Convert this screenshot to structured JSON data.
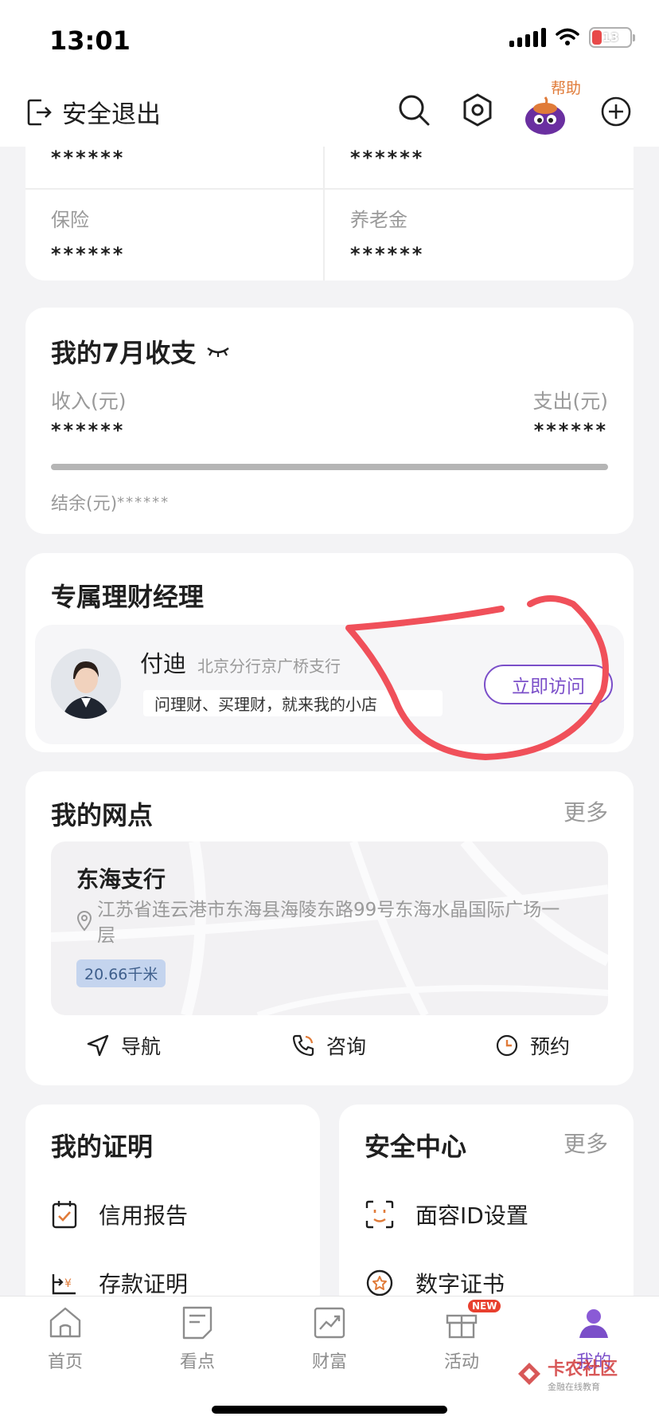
{
  "status_bar": {
    "time": "13:01",
    "battery": "13"
  },
  "top_nav": {
    "logout_label": "安全退出",
    "help_label": "帮助"
  },
  "assets": {
    "cells": [
      {
        "label": "",
        "value": "******"
      },
      {
        "label": "",
        "value": "******"
      },
      {
        "label": "保险",
        "value": "******"
      },
      {
        "label": "养老金",
        "value": "******"
      }
    ]
  },
  "income": {
    "title": "我的7月收支",
    "income_label": "收入(元)",
    "income_value": "******",
    "expense_label": "支出(元)",
    "expense_value": "******",
    "balance_label": "结余(元)",
    "balance_value": "******"
  },
  "manager": {
    "title": "专属理财经理",
    "name": "付迪",
    "branch": "北京分行京广桥支行",
    "slogan": "问理财、买理财，就来我的小店",
    "visit_label": "立即访问",
    "annotation_color": "#f0505a"
  },
  "branch": {
    "title": "我的网点",
    "more_label": "更多",
    "name": "东海支行",
    "address": "江苏省连云港市东海县海陵东路99号东海水晶国际广场一层",
    "distance": "20.66千米",
    "actions": {
      "navigate": "导航",
      "consult": "咨询",
      "reserve": "预约"
    }
  },
  "certificates": {
    "title": "我的证明",
    "items": [
      "信用报告",
      "存款证明"
    ]
  },
  "security": {
    "title": "安全中心",
    "more_label": "更多",
    "items": [
      "面容ID设置",
      "数字证书"
    ]
  },
  "tabs": [
    {
      "label": "首页",
      "icon": "home-icon"
    },
    {
      "label": "看点",
      "icon": "news-icon"
    },
    {
      "label": "财富",
      "icon": "wealth-chart-icon"
    },
    {
      "label": "活动",
      "icon": "gift-icon",
      "badge": "NEW"
    },
    {
      "label": "我的",
      "icon": "user-icon",
      "active": true
    }
  ],
  "watermark": {
    "main": "卡农社区",
    "sub": "金融在线教育"
  },
  "colors": {
    "accent": "#7b4fc9",
    "help": "#e07b39",
    "annotation": "#f0505a"
  }
}
